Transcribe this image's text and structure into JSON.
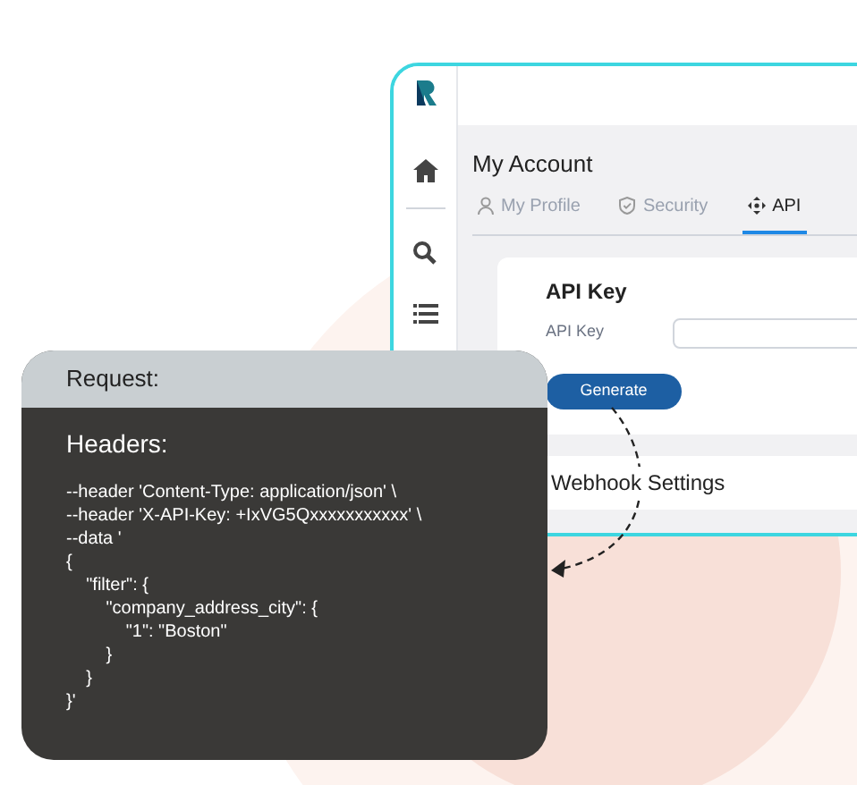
{
  "app": {
    "title": "My Account",
    "tabs": [
      {
        "label": "My Profile",
        "kind": "person",
        "selected": false
      },
      {
        "label": "Security",
        "kind": "shield",
        "selected": false
      },
      {
        "label": "API",
        "kind": "move",
        "selected": true
      }
    ],
    "api_key_card": {
      "title": "API Key",
      "field_label": "API Key",
      "button": "Generate"
    },
    "webhook_section": {
      "title": "Webhook Settings"
    }
  },
  "request_panel": {
    "title": "Request:",
    "heading": "Headers:",
    "code_lines": [
      "--header 'Content-Type: application/json' \\",
      "--header 'X-API-Key: +IxVG5Qxxxxxxxxxxx' \\",
      "--data '",
      "{",
      "    \"filter\": {",
      "        \"company_address_city\": {",
      "            \"1\": \"Boston\"",
      "        }",
      "    }",
      "}'"
    ]
  }
}
